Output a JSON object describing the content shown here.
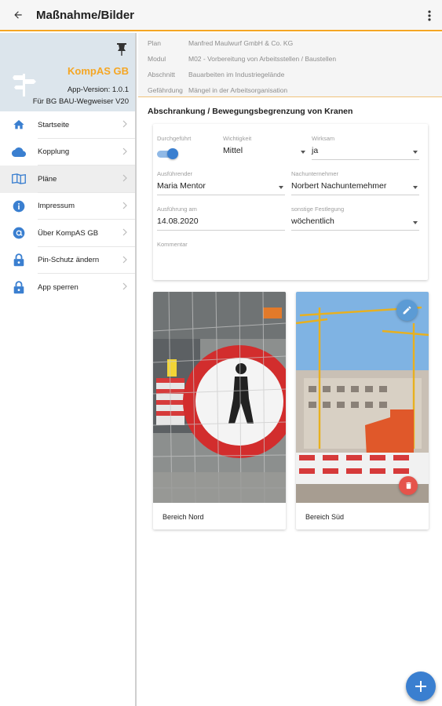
{
  "appbar": {
    "title": "Maßnahme/Bilder"
  },
  "sidebar": {
    "app_name": "KompAS GB",
    "version": "App-Version: 1.0.1",
    "for_label": "Für BG BAU-Wegweiser V20",
    "items": [
      {
        "label": "Startseite",
        "icon": "home-icon"
      },
      {
        "label": "Kopplung",
        "icon": "cloud-icon"
      },
      {
        "label": "Pläne",
        "icon": "map-book-icon"
      },
      {
        "label": "Impressum",
        "icon": "info-icon"
      },
      {
        "label": "Über KompAS GB",
        "icon": "at-icon"
      },
      {
        "label": "Pin-Schutz ändern",
        "icon": "lock-icon"
      },
      {
        "label": "App sperren",
        "icon": "lock-icon"
      }
    ]
  },
  "info": {
    "rows": [
      {
        "key": "Plan",
        "value": "Manfred Maulwurf GmbH & Co. KG"
      },
      {
        "key": "Modul",
        "value": "M02 - Vorbereitung von Arbeitsstellen / Baustellen"
      },
      {
        "key": "Abschnitt",
        "value": "Bauarbeiten im Industriegelände"
      },
      {
        "key": "Gefährdung",
        "value": "Mängel in der Arbeitsorganisation"
      }
    ]
  },
  "section_title": "Abschrankung / Bewegungsbegrenzung von Kranen",
  "form": {
    "durchgefuehrt": {
      "label": "Durchgeführt",
      "checked": true
    },
    "wichtigkeit": {
      "label": "Wichtigkeit",
      "value": "Mittel"
    },
    "wirksam": {
      "label": "Wirksam",
      "value": "ja"
    },
    "ausfuehrender": {
      "label": "Ausführender",
      "value": "Maria Mentor"
    },
    "nachunternehmer": {
      "label": "Nachunternehmer",
      "value": "Norbert Nachuntemehmer"
    },
    "ausfuehrung_am": {
      "label": "Ausführung am",
      "value": "14.08.2020"
    },
    "festlegung": {
      "label": "sonstige Festlegung",
      "value": "wöchentlich"
    },
    "kommentar": {
      "label": "Kommentar",
      "value": ""
    }
  },
  "photos": [
    {
      "caption": "Bereich Nord"
    },
    {
      "caption": "Bereich Süd"
    }
  ],
  "colors": {
    "accent_orange": "#f5a623",
    "primary_blue": "#3a7fd0",
    "delete_red": "#e5534b"
  }
}
